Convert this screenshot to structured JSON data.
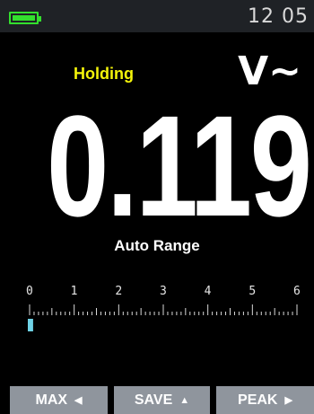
{
  "status": {
    "time": "12 05",
    "battery_icon": "battery-full-icon",
    "battery_color": "#33e02e"
  },
  "display": {
    "hold_label": "Holding",
    "hold_color": "#f4f40a",
    "unit": "V~",
    "reading": "0.119",
    "range_label": "Auto Range"
  },
  "bargraph": {
    "tick_labels": [
      "0",
      "1",
      "2",
      "3",
      "4",
      "5",
      "6"
    ],
    "scale_min": 0,
    "scale_max": 6,
    "value": 0.119,
    "indicator_color": "#6fd3e6"
  },
  "softkeys": [
    {
      "label": "MAX",
      "arrow": "◀",
      "icon": "left-arrow-icon"
    },
    {
      "label": "SAVE",
      "arrow": "▲",
      "icon": "up-arrow-icon"
    },
    {
      "label": "PEAK",
      "arrow": "▶",
      "icon": "right-arrow-icon"
    }
  ]
}
